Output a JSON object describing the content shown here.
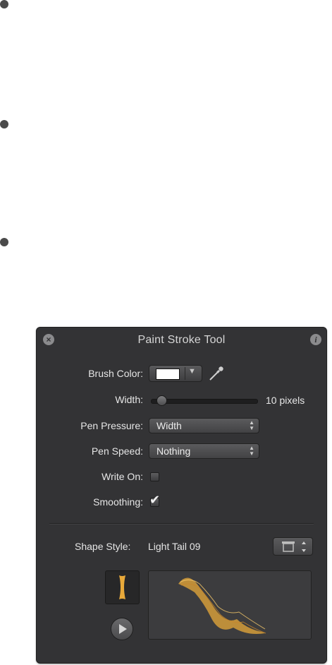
{
  "hud": {
    "title": "Paint Stroke Tool",
    "brush_color": {
      "label": "Brush Color:",
      "value": "#ffffff"
    },
    "width": {
      "label": "Width:",
      "value_text": "10 pixels",
      "slider_fraction": 0.06
    },
    "pen_pressure": {
      "label": "Pen Pressure:",
      "value": "Width"
    },
    "pen_speed": {
      "label": "Pen Speed:",
      "value": "Nothing"
    },
    "write_on": {
      "label": "Write On:",
      "checked": false
    },
    "smoothing": {
      "label": "Smoothing:",
      "checked": true
    },
    "shape_style": {
      "label": "Shape Style:",
      "value": "Light Tail 09"
    }
  },
  "icons": {
    "close": "close-icon",
    "info": "info-icon",
    "eyedropper": "eyedropper-icon",
    "library": "shape-library-icon",
    "play": "play-icon"
  },
  "colors": {
    "hud_bg": "#333335",
    "accent_stroke": "#e8a93a"
  }
}
